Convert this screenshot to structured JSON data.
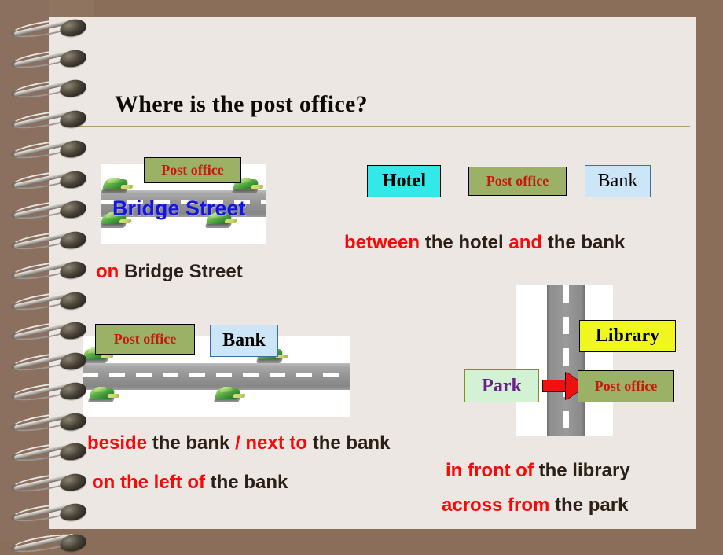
{
  "slide": {
    "background_color": "#8b6e59",
    "page_color": "#ece7e3",
    "title": "Where is the post office?"
  },
  "scene_bridge_street": {
    "street_label": "Bridge Street",
    "post_office_label": "Post office",
    "caption": {
      "highlight": "on",
      "rest": "Bridge Street"
    }
  },
  "scene_between": {
    "boxes": [
      {
        "label": "Hotel",
        "fill": "#33e8e8",
        "border": "#000000",
        "text_color": "#000000"
      },
      {
        "label": "Post office",
        "fill": "#9bb166",
        "border": "#000000",
        "text_color": "#c41a09"
      },
      {
        "label": "Bank",
        "fill": "#cce6f7",
        "border": "#3b6ea5",
        "text_color": "#000000"
      }
    ],
    "caption": {
      "part1": "between",
      "part2": " the hotel ",
      "part3": "and",
      "part4": " the bank"
    }
  },
  "scene_beside": {
    "post_office_label": "Post office",
    "bank_label": "Bank",
    "caption_line1": {
      "part1": "beside",
      "part2": " the bank ",
      "part3": "/ next to",
      "part4": " the bank"
    },
    "caption_line2": {
      "part1": "on the left of",
      "part2": " the bank"
    }
  },
  "scene_in_front": {
    "library_label": "Library",
    "park_label": "Park",
    "post_office_label": "Post office",
    "arrow": "right-arrow",
    "caption_line1": {
      "part1": "in front of",
      "part2": " the library"
    },
    "caption_line2": {
      "part1": "across from",
      "part2": " the park"
    }
  },
  "colors": {
    "red_highlight": "#fb0707",
    "dark_text": "#2b2018",
    "post_office_fill": "#9bb166",
    "post_office_text": "#c41a09",
    "hotel_fill": "#33e8e8",
    "bank_fill": "#cce6f7",
    "library_fill": "#eff71e",
    "park_fill": "#d3f2d3",
    "park_text": "#6b1f8c",
    "rule_color": "#b39b63"
  }
}
